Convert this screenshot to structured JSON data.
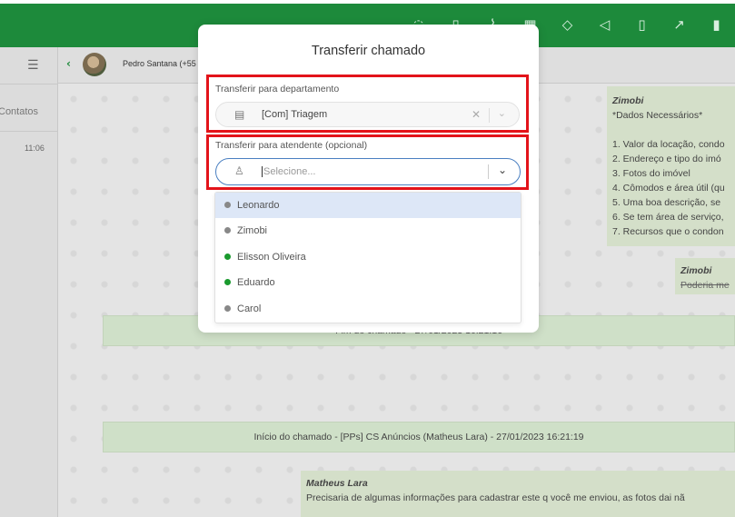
{
  "topbar": {
    "icons": [
      "chat-icon",
      "phone-icon",
      "attach-icon",
      "building-icon",
      "tag-icon",
      "megaphone-icon",
      "vibrate-icon",
      "chart-icon",
      "more-icon"
    ],
    "colors": {
      "bar": "#1d8a3b"
    }
  },
  "leftcol": {
    "contacts_label": "Contatos",
    "time": "11:06"
  },
  "chathead": {
    "contact_name": "Pedro Santana (+55 1"
  },
  "messages": {
    "right1": {
      "author": "Zimobi",
      "lines": [
        "*Dados Necessários*",
        "",
        "1. Valor da locação, condo",
        "2. Endereço e tipo do imó",
        "3. Fotos do imóvel",
        "4. Cômodos e área útil (qu",
        "5. Uma boa descrição, se",
        "6. Se tem área de serviço,",
        "7. Recursos que o condon"
      ]
    },
    "right2": {
      "author": "Zimobi",
      "text": "Poderia me"
    },
    "system1": "Fim do chamado - 27/01/2023 16:21:16",
    "system2": "Início do chamado - [PPs] CS Anúncios (Matheus Lara) - 27/01/2023 16:21:19",
    "bottom": {
      "author": "Matheus Lara",
      "text": "Precisaria de algumas informações para cadastrar este q você me enviou, as fotos dai nã"
    }
  },
  "modal": {
    "title": "Transferir chamado",
    "department": {
      "label": "Transferir para departamento",
      "value": "[Com] Triagem"
    },
    "attendant": {
      "label": "Transferir para atendente (opcional)",
      "placeholder": "Selecione..."
    },
    "options": [
      {
        "name": "Leonardo",
        "status_color": "#888888"
      },
      {
        "name": "Zimobi",
        "status_color": "#888888"
      },
      {
        "name": "Elisson Oliveira",
        "status_color": "#1a9a2e"
      },
      {
        "name": "Eduardo",
        "status_color": "#1a9a2e"
      },
      {
        "name": "Carol",
        "status_color": "#888888"
      }
    ]
  }
}
